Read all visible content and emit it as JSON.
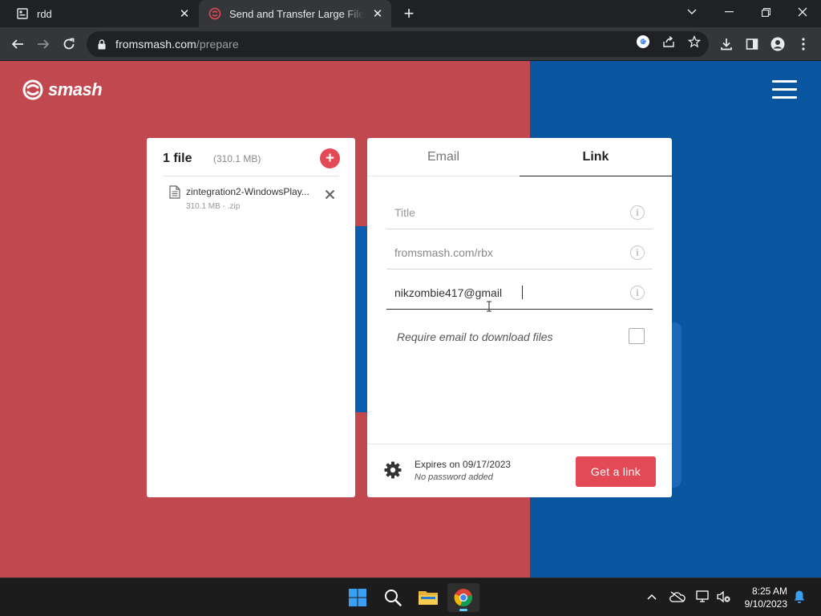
{
  "browser": {
    "tabs": [
      {
        "title": "rdd",
        "icon": "page-icon"
      },
      {
        "title": "Send and Transfer Large Files Online",
        "icon": "smash-favicon"
      }
    ],
    "url_domain": "fromsmash.com",
    "url_path": "/prepare"
  },
  "app": {
    "brand": "smash",
    "colors": {
      "left_bg": "#c1484f",
      "right_bg": "#0a55a0",
      "accent": "#e34a55"
    }
  },
  "files_panel": {
    "count_label": "1 file",
    "total_size": "(310.1 MB)",
    "add_label": "+",
    "items": [
      {
        "name": "zintegration2-WindowsPlay...",
        "meta": "310.1 MB - .zip"
      }
    ]
  },
  "transfer_panel": {
    "tabs": [
      "Email",
      "Link"
    ],
    "selected_tab": "Link",
    "fields": {
      "title_placeholder": "Title",
      "url_value": "fromsmash.com/rbx",
      "email_value": "nikzombie417@gmail"
    },
    "require_email_label": "Require email to download files",
    "require_email_checked": false,
    "expires": "Expires on 09/17/2023",
    "password": "No password added",
    "cta": "Get a link"
  },
  "taskbar": {
    "time": "8:25 AM",
    "date": "9/10/2023"
  }
}
